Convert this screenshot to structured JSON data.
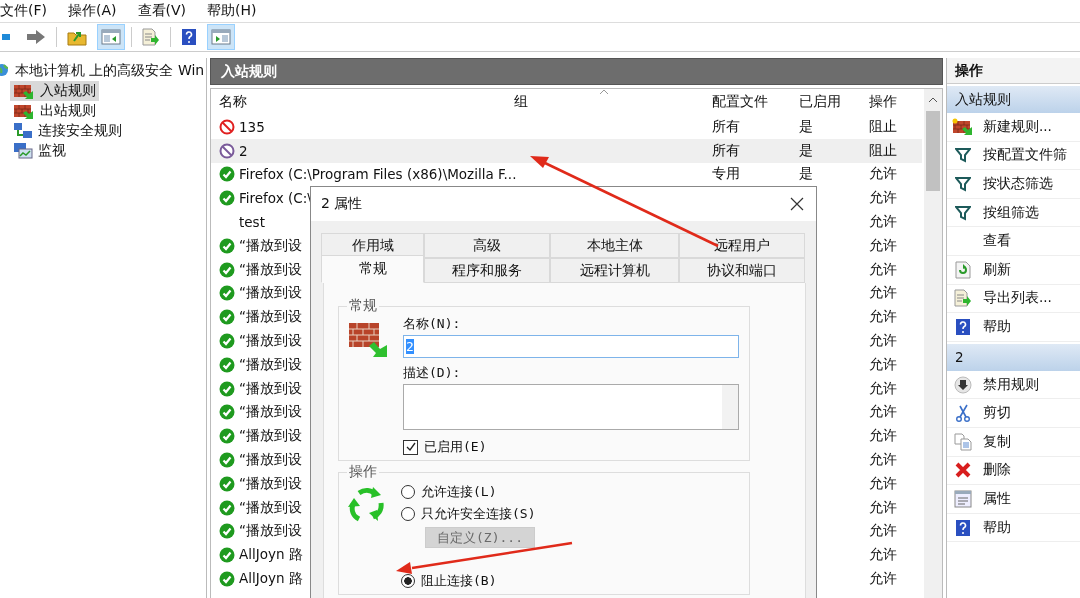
{
  "menu": [
    "文件(F)",
    "操作(A)",
    "查看(V)",
    "帮助(H)"
  ],
  "toolbar": [
    {
      "kind": "back",
      "on": false
    },
    {
      "kind": "forward",
      "on": false
    },
    {
      "kind": "folder-up",
      "on": false
    },
    {
      "kind": "pane-left",
      "on": true
    },
    {
      "kind": "export",
      "on": false
    },
    {
      "kind": "help",
      "on": false
    },
    {
      "kind": "pane-right",
      "on": true
    }
  ],
  "tree": {
    "label": "本地计算机 上的高级安全 Win",
    "kind": "root",
    "children": [
      {
        "label": "入站规则",
        "kind": "inbound",
        "selected": true
      },
      {
        "label": "出站规则",
        "kind": "outbound",
        "selected": false
      },
      {
        "label": "连接安全规则",
        "kind": "security",
        "selected": false
      },
      {
        "label": "监视",
        "kind": "monitor",
        "selected": false
      }
    ]
  },
  "rules": {
    "title": "入站规则",
    "columns": [
      "名称",
      "组",
      "配置文件",
      "已启用",
      "操作"
    ],
    "rows": [
      {
        "name": "135",
        "kind": "block",
        "profile": "所有",
        "enabled": "是",
        "action": "阻止",
        "selected": false
      },
      {
        "name": "2",
        "kind": "block-disabled",
        "profile": "所有",
        "enabled": "是",
        "action": "阻止",
        "selected": true
      },
      {
        "name": "Firefox (C:\\Program Files (x86)\\Mozilla F...",
        "kind": "allow",
        "profile": "专用",
        "enabled": "是",
        "action": "允许",
        "selected": false
      },
      {
        "name": "Firefox (C:\\",
        "kind": "allow",
        "action": "允许",
        "selected": false
      },
      {
        "name": "test",
        "kind": "none",
        "action": "允许",
        "selected": false
      },
      {
        "name": "“播放到设",
        "kind": "allow",
        "action": "允许",
        "selected": false
      },
      {
        "name": "“播放到设",
        "kind": "allow",
        "action": "允许",
        "selected": false
      },
      {
        "name": "“播放到设",
        "kind": "allow",
        "action": "允许",
        "selected": false
      },
      {
        "name": "“播放到设",
        "kind": "allow",
        "action": "允许",
        "selected": false
      },
      {
        "name": "“播放到设",
        "kind": "allow",
        "action": "允许",
        "selected": false
      },
      {
        "name": "“播放到设",
        "kind": "allow",
        "action": "允许",
        "selected": false
      },
      {
        "name": "“播放到设",
        "kind": "allow",
        "action": "允许",
        "selected": false
      },
      {
        "name": "“播放到设",
        "kind": "allow",
        "action": "允许",
        "selected": false
      },
      {
        "name": "“播放到设",
        "kind": "allow",
        "action": "允许",
        "selected": false
      },
      {
        "name": "“播放到设",
        "kind": "allow",
        "action": "允许",
        "selected": false
      },
      {
        "name": "“播放到设",
        "kind": "allow",
        "action": "允许",
        "selected": false
      },
      {
        "name": "“播放到设",
        "kind": "allow",
        "action": "允许",
        "selected": false
      },
      {
        "name": "“播放到设",
        "kind": "allow",
        "action": "允许",
        "selected": false
      },
      {
        "name": "AllJoyn 路",
        "kind": "allow",
        "action": "允许",
        "selected": false
      },
      {
        "name": "AllJoyn 路",
        "kind": "allow",
        "action": "允许",
        "selected": false
      }
    ]
  },
  "actions": {
    "title": "操作",
    "sections": [
      {
        "title": "入站规则",
        "items": [
          {
            "label": "新建规则...",
            "kind": "new-rule"
          },
          {
            "label": "按配置文件筛",
            "kind": "filter"
          },
          {
            "label": "按状态筛选",
            "kind": "filter"
          },
          {
            "label": "按组筛选",
            "kind": "filter"
          },
          {
            "label": "查看",
            "kind": "none"
          },
          {
            "label": "刷新",
            "kind": "refresh"
          },
          {
            "label": "导出列表...",
            "kind": "export"
          },
          {
            "label": "帮助",
            "kind": "help"
          }
        ]
      },
      {
        "title": "2",
        "items": [
          {
            "label": "禁用规则",
            "kind": "disable"
          },
          {
            "label": "剪切",
            "kind": "cut"
          },
          {
            "label": "复制",
            "kind": "copy"
          },
          {
            "label": "删除",
            "kind": "delete"
          },
          {
            "label": "属性",
            "kind": "properties"
          },
          {
            "label": "帮助",
            "kind": "help"
          }
        ]
      }
    ]
  },
  "dialog": {
    "title": "2 属性",
    "tab_rows": [
      [
        {
          "label": "作用域",
          "selected": false
        },
        {
          "label": "高级",
          "selected": false
        },
        {
          "label": "本地主体",
          "selected": false
        },
        {
          "label": "远程用户",
          "selected": false
        }
      ],
      [
        {
          "label": "常规",
          "selected": true
        },
        {
          "label": "程序和服务",
          "selected": false
        },
        {
          "label": "远程计算机",
          "selected": false
        },
        {
          "label": "协议和端口",
          "selected": false
        }
      ]
    ],
    "general": {
      "legend": "常规",
      "name_label": "名称(N):",
      "name_value": "2",
      "description_label": "描述(D):",
      "enabled_label": "已启用(E)",
      "enabled": true
    },
    "action": {
      "legend": "操作",
      "options": [
        {
          "kind": "radio",
          "label": "允许连接(L)",
          "selected": false
        },
        {
          "kind": "radio",
          "label": "只允许安全连接(S)",
          "selected": false
        },
        {
          "kind": "button",
          "label": "自定义(Z)...",
          "disabled": true
        },
        {
          "kind": "radio",
          "label": "阻止连接(B)",
          "selected": true
        }
      ]
    }
  }
}
